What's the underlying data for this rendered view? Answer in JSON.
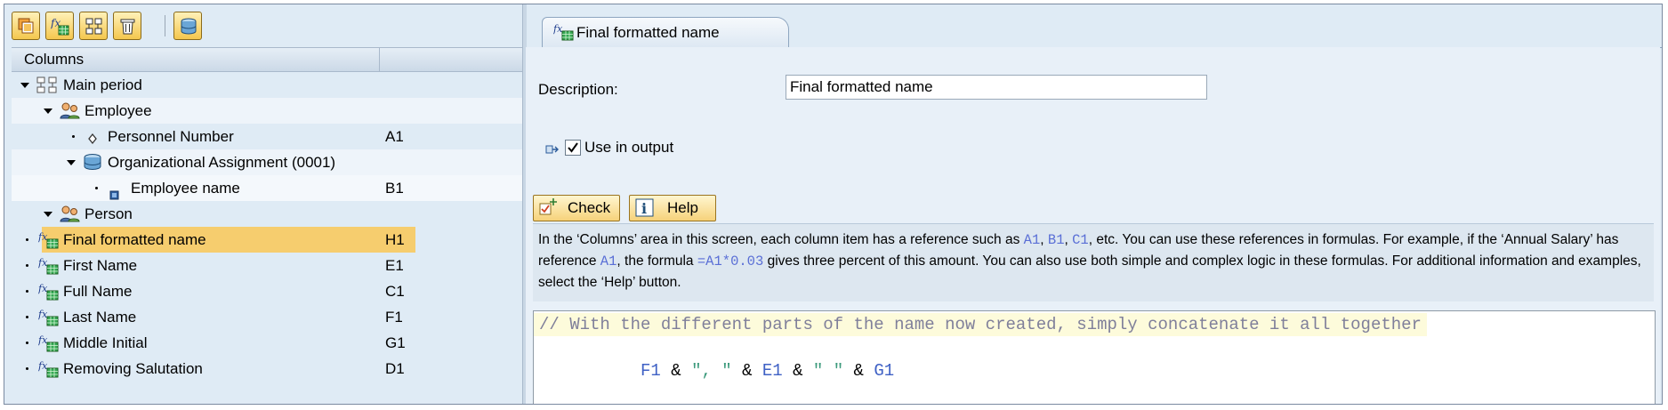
{
  "toolbar": {
    "buttons": [
      {
        "name": "create-column-button",
        "icon": "new-column-icon"
      },
      {
        "name": "create-formula-button",
        "icon": "formula-icon"
      },
      {
        "name": "group-button",
        "icon": "hierarchy-icon"
      },
      {
        "name": "delete-button",
        "icon": "trash-icon"
      },
      {
        "name": "database-button",
        "icon": "database-icon"
      }
    ]
  },
  "columns_panel": {
    "header": "Columns",
    "tree": [
      {
        "label": "Main period",
        "ref": "",
        "icon": "hierarchy-icon",
        "expanded": true
      },
      {
        "label": "Employee",
        "ref": "",
        "icon": "people-icon",
        "expanded": true
      },
      {
        "label": "Personnel Number",
        "ref": "A1",
        "icon": "key-icon"
      },
      {
        "label": "Organizational Assignment (0001)",
        "ref": "",
        "icon": "database-icon",
        "expanded": true
      },
      {
        "label": "Employee name",
        "ref": "B1",
        "icon": "field-icon"
      },
      {
        "label": "Person",
        "ref": "",
        "icon": "people-icon",
        "expanded": true
      },
      {
        "label": "Final formatted name",
        "ref": "H1",
        "icon": "formula-icon",
        "selected": true
      },
      {
        "label": "First Name",
        "ref": "E1",
        "icon": "formula-icon"
      },
      {
        "label": "Full Name",
        "ref": "C1",
        "icon": "formula-icon"
      },
      {
        "label": "Last Name",
        "ref": "F1",
        "icon": "formula-icon"
      },
      {
        "label": "Middle Initial",
        "ref": "G1",
        "icon": "formula-icon"
      },
      {
        "label": "Removing Salutation",
        "ref": "D1",
        "icon": "formula-icon"
      }
    ]
  },
  "detail": {
    "tab_label": "Final formatted name",
    "description_label": "Description:",
    "description_value": "Final formatted name",
    "use_in_output_label": "Use in output",
    "use_in_output_checked": true,
    "check_button": "Check",
    "help_button": "Help",
    "info": {
      "p1": "In the ‘Columns’ area in this screen, each column item has a reference such as ",
      "r1": "A1",
      "p2": ", ",
      "r2": "B1",
      "p3": ", ",
      "r3": "C1",
      "p4": ", etc. You can use these references in formulas. For example, if the ‘Annual Salary’ has reference ",
      "r4": "A1",
      "p5": ", the formula ",
      "r5": "=A1*0.03",
      "p6": " gives three percent of this amount. You can also use both simple and complex logic in these formulas. For additional information and examples, select the ‘Help’ button."
    },
    "formula": {
      "comment": "// With the different parts of the name now created, simply concatenate it all together",
      "tokens": [
        {
          "t": "F1",
          "k": "ref"
        },
        {
          "t": " & ",
          "k": "op"
        },
        {
          "t": "\", \"",
          "k": "str"
        },
        {
          "t": " & ",
          "k": "op"
        },
        {
          "t": "E1",
          "k": "ref"
        },
        {
          "t": " & ",
          "k": "op"
        },
        {
          "t": "\" \"",
          "k": "str"
        },
        {
          "t": " & ",
          "k": "op"
        },
        {
          "t": "G1",
          "k": "ref"
        }
      ]
    }
  },
  "colors": {
    "selection": "#f6cd6e",
    "reference": "#3f61c5",
    "string": "#3c9a7c",
    "comment": "#7f7f9a"
  }
}
